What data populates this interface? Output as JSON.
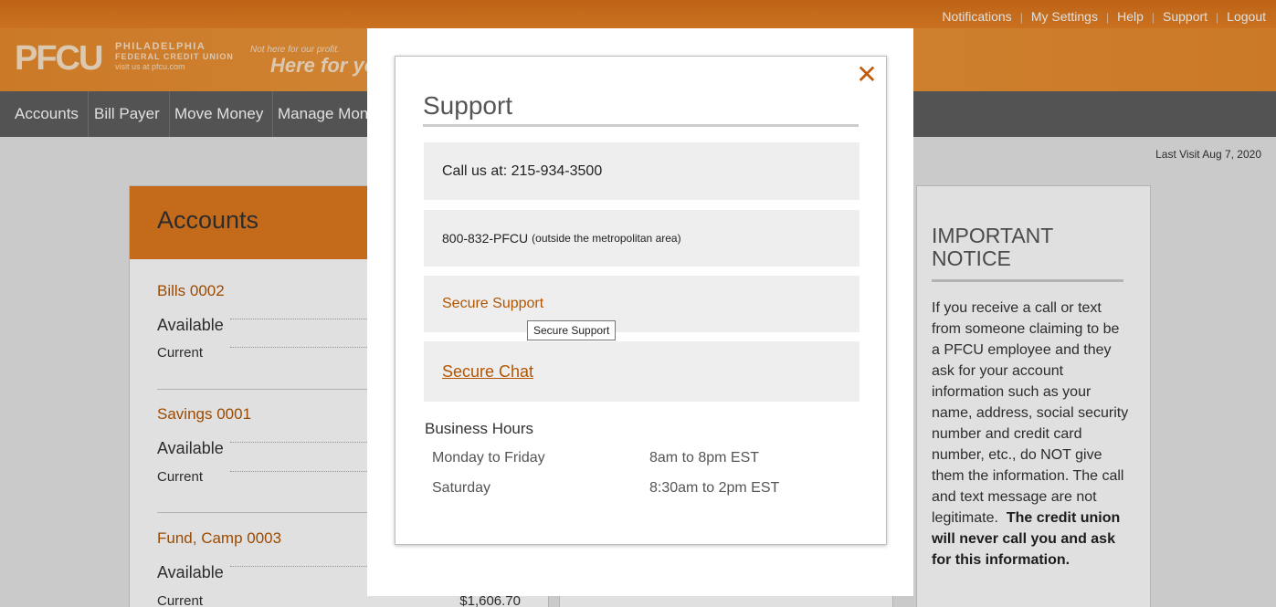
{
  "top_links": [
    "Notifications",
    "My Settings",
    "Help",
    "Support",
    "Logout"
  ],
  "brand": {
    "logo": "PFCU",
    "name_line1": "PHILADELPHIA",
    "name_line2": "FEDERAL CREDIT UNION",
    "name_line3": "visit us at pfcu.com",
    "tagline_small": "Not here for our profit.",
    "tagline_big": "Here for you"
  },
  "nav": [
    "Accounts",
    "Bill Payer",
    "Move Money",
    "Manage Mone"
  ],
  "last_visit": "Last Visit Aug 7, 2020",
  "accounts": {
    "title": "Accounts",
    "items": [
      {
        "name": "Bills  0002",
        "available_label": "Available",
        "current_label": "Current"
      },
      {
        "name": "Savings  0001",
        "available_label": "Available",
        "current_label": "Current"
      },
      {
        "name": "Fund, Camp  0003",
        "available_label": "Available",
        "current_label": "Current",
        "current_amount": "$1,606.70"
      }
    ]
  },
  "notice": {
    "title": "IMPORTANT NOTICE",
    "body": "If you receive a call or text from someone claiming to be a PFCU employee and they ask for your account information such as your name, address, social security number and credit card number, etc., do NOT give them the information. The call and text message are not legitimate.",
    "body_bold": "The credit union will never call you and ask for this information."
  },
  "modal": {
    "close": "✕",
    "title": "Support",
    "call_us": "Call us at: 215-934-3500",
    "toll_free": "800-832-PFCU",
    "toll_free_note": "(outside the metropolitan area)",
    "secure_support": "Secure Support",
    "tooltip": "Secure Support",
    "secure_chat": "Secure Chat",
    "hours_title": "Business Hours",
    "hours": [
      {
        "day": "Monday to Friday",
        "time": "8am to 8pm EST"
      },
      {
        "day": "Saturday",
        "time": "8:30am to 2pm EST"
      }
    ]
  },
  "colors": {
    "brand_orange": "#e07a1f",
    "link_orange": "#b35500",
    "nav_gray": "#5f5f5f"
  }
}
